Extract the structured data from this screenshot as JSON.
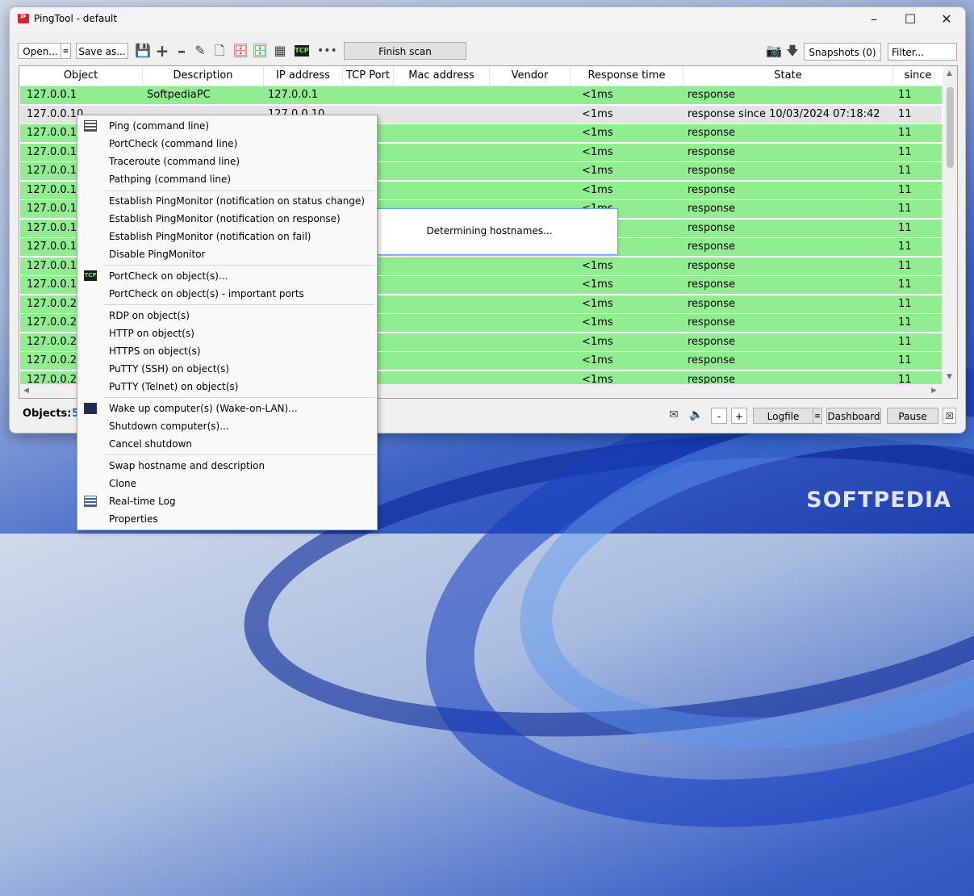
{
  "window": {
    "title": "PingTool - default"
  },
  "toolbar": {
    "open_label": "Open...",
    "save_label": "Save as...",
    "finish_scan_label": "Finish scan",
    "tcp_icon_text": "TCP",
    "snapshots_label": "Snapshots (0)",
    "filter_value": "Filter..."
  },
  "columns": [
    "Object",
    "Description",
    "IP address",
    "TCP Port",
    "Mac address",
    "Vendor",
    "Response time",
    "State",
    "since"
  ],
  "rows": [
    {
      "object": "127.0.0.1",
      "description": "SoftpediaPC",
      "ip": "127.0.0.1",
      "response_time": "<1ms",
      "state": "response",
      "since": "11"
    },
    {
      "object": "127.0.0.10",
      "description": "",
      "ip": "127.0.0.10",
      "response_time": "<1ms",
      "state": "response since 10/03/2024 07:18:42",
      "since": "11"
    },
    {
      "object": "127.0.0.11",
      "description": "",
      "ip": "",
      "response_time": "<1ms",
      "state": "response",
      "since": "11"
    },
    {
      "object": "127.0.0.12",
      "description": "",
      "ip": "",
      "response_time": "<1ms",
      "state": "response",
      "since": "11"
    },
    {
      "object": "127.0.0.13",
      "description": "",
      "ip": "",
      "response_time": "<1ms",
      "state": "response",
      "since": "11"
    },
    {
      "object": "127.0.0.14",
      "description": "",
      "ip": "",
      "response_time": "<1ms",
      "state": "response",
      "since": "11"
    },
    {
      "object": "127.0.0.15",
      "description": "",
      "ip": "",
      "response_time": "<1ms",
      "state": "response",
      "since": "11"
    },
    {
      "object": "127.0.0.16",
      "description": "",
      "ip": "",
      "response_time": "",
      "state": "response",
      "since": "11"
    },
    {
      "object": "127.0.0.17",
      "description": "",
      "ip": "",
      "response_time": "",
      "state": "response",
      "since": "11"
    },
    {
      "object": "127.0.0.18",
      "description": "",
      "ip": "",
      "response_time": "<1ms",
      "state": "response",
      "since": "11"
    },
    {
      "object": "127.0.0.19",
      "description": "",
      "ip": "",
      "response_time": "<1ms",
      "state": "response",
      "since": "11"
    },
    {
      "object": "127.0.0.2",
      "description": "",
      "ip": "",
      "response_time": "<1ms",
      "state": "response",
      "since": "11"
    },
    {
      "object": "127.0.0.20",
      "description": "",
      "ip": "",
      "response_time": "<1ms",
      "state": "response",
      "since": "11"
    },
    {
      "object": "127.0.0.21",
      "description": "",
      "ip": "",
      "response_time": "<1ms",
      "state": "response",
      "since": "11"
    },
    {
      "object": "127.0.0.22",
      "description": "",
      "ip": "",
      "response_time": "<1ms",
      "state": "response",
      "since": "11"
    },
    {
      "object": "127.0.0.23",
      "description": "",
      "ip": "",
      "response_time": "<1ms",
      "state": "response",
      "since": "11"
    }
  ],
  "status": {
    "objects_label": "Objects:",
    "objects_count": "5",
    "minus_label": "-",
    "plus_label": "+",
    "logfile_label": "Logfile",
    "dashboard_label": "Dashboard",
    "pause_label": "Pause"
  },
  "popup": {
    "text": "Determining hostnames..."
  },
  "context_menu": {
    "items": [
      "Ping (command line)",
      "PortCheck (command line)",
      "Traceroute (command line)",
      "Pathping (command line)",
      "Establish PingMonitor (notification on status change)",
      "Establish PingMonitor (notification on response)",
      "Establish PingMonitor (notification on fail)",
      "Disable PingMonitor",
      "PortCheck on object(s)...",
      "PortCheck on object(s) - important ports",
      "RDP on object(s)",
      "HTTP on object(s)",
      "HTTPS on object(s)",
      "PuTTY (SSH) on object(s)",
      "PuTTY (Telnet) on object(s)",
      "Wake up computer(s) (Wake-on-LAN)...",
      "Shutdown computer(s)...",
      "Cancel shutdown",
      "Swap hostname and description",
      "Clone",
      "Real-time Log",
      "Properties"
    ]
  },
  "watermark": "SOFTPEDIA"
}
